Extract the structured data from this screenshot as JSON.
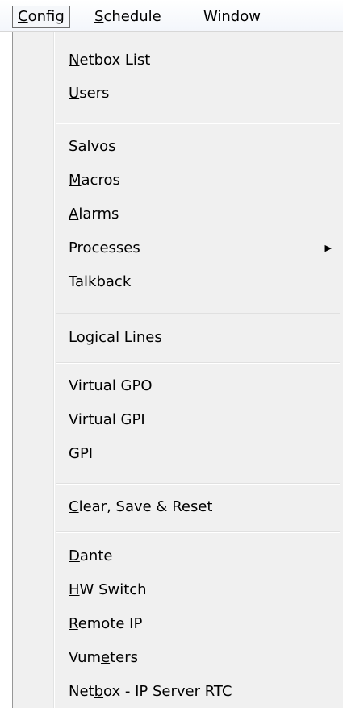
{
  "menubar": {
    "items": [
      {
        "pre": "",
        "key": "C",
        "post": "onfig"
      },
      {
        "pre": "",
        "key": "S",
        "post": "chedule"
      },
      {
        "pre": "",
        "key": "",
        "post": "Window"
      }
    ]
  },
  "dropdown": {
    "items": [
      {
        "pre": "",
        "key": "N",
        "post": "etbox List"
      },
      {
        "pre": "",
        "key": "U",
        "post": "sers"
      },
      {
        "pre": "",
        "key": "S",
        "post": "alvos"
      },
      {
        "pre": "",
        "key": "M",
        "post": "acros"
      },
      {
        "pre": "",
        "key": "A",
        "post": "larms"
      },
      {
        "pre": "",
        "key": "",
        "post": "Processes"
      },
      {
        "pre": "",
        "key": "",
        "post": "Talkback"
      },
      {
        "pre": "",
        "key": "",
        "post": "Logical Lines"
      },
      {
        "pre": "",
        "key": "",
        "post": "Virtual GPO"
      },
      {
        "pre": "",
        "key": "",
        "post": "Virtual GPI"
      },
      {
        "pre": "",
        "key": "",
        "post": "GPI"
      },
      {
        "pre": "",
        "key": "C",
        "post": "lear, Save & Reset"
      },
      {
        "pre": "",
        "key": "D",
        "post": "ante"
      },
      {
        "pre": "",
        "key": "H",
        "post": "W Switch"
      },
      {
        "pre": "",
        "key": "R",
        "post": "emote IP"
      },
      {
        "pre": "Vum",
        "key": "e",
        "post": "ters"
      },
      {
        "pre": "Net",
        "key": "b",
        "post": "ox - IP Server RTC"
      }
    ],
    "submenu_arrow": "▶"
  }
}
